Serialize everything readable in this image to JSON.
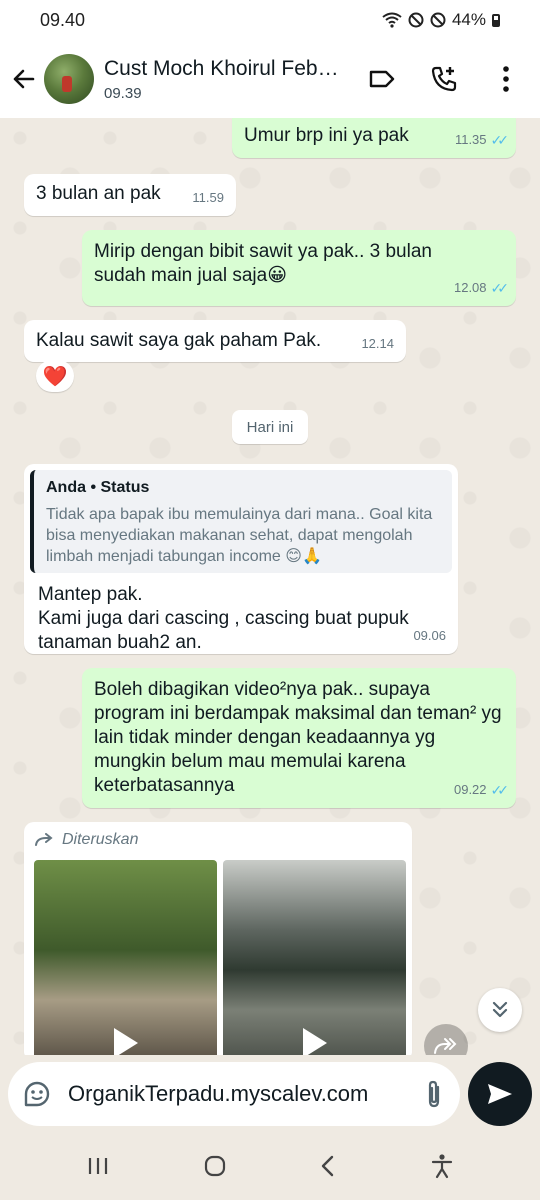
{
  "status_bar": {
    "time": "09.40",
    "battery": "44%"
  },
  "header": {
    "contact_name": "Cust Moch Khoirul Febri...",
    "last_seen": "09.39"
  },
  "messages": [
    {
      "dir": "out",
      "text": "Umur brp ini ya pak",
      "time": "11.35"
    },
    {
      "dir": "in",
      "text": "3 bulan an pak",
      "time": "11.59"
    },
    {
      "dir": "out",
      "text": "Mirip dengan bibit sawit ya pak.. 3 bulan sudah main jual saja😀",
      "time": "12.08"
    },
    {
      "dir": "in",
      "text": "Kalau sawit saya gak paham Pak.",
      "time": "12.14",
      "reaction": "❤️"
    },
    {
      "dir": "in",
      "quote_title": "Anda • Status",
      "quote_text": "Tidak apa bapak ibu memulainya dari mana.. Goal kita bisa menyediakan makanan sehat, dapat mengolah limbah menjadi tabungan income 😊🙏",
      "text": "Mantep pak.\nKami juga dari cascing , cascing buat pupuk tanaman buah2 an.",
      "time": "09.06"
    },
    {
      "dir": "out",
      "text": "Boleh dibagikan video²nya pak.. supaya program ini berdampak maksimal dan teman² yg lain tidak minder dengan keadaannya yg mungkin belum mau memulai karena keterbatasannya",
      "time": "09.22"
    },
    {
      "dir": "in",
      "forwarded_label": "Diteruskan"
    }
  ],
  "day_separator": "Hari ini",
  "composer": {
    "text": "OrganikTerpadu.myscalev.com"
  }
}
